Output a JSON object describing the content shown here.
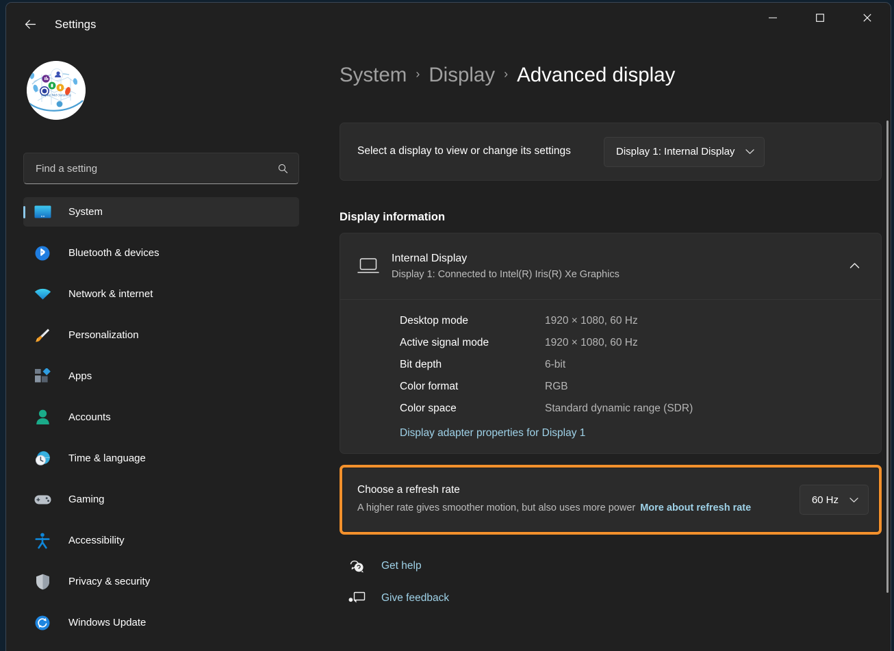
{
  "window": {
    "app_title": "Settings",
    "back_icon": "back-arrow-icon",
    "minimize_icon": "minimize-icon",
    "maximize_icon": "maximize-icon",
    "close_icon": "close-icon"
  },
  "sidebar": {
    "avatar_alt": "user-avatar-network-globe-logo",
    "search": {
      "placeholder": "Find a setting",
      "value": "",
      "icon": "search-icon"
    },
    "items": [
      {
        "label": "System",
        "icon": "monitor-icon",
        "selected": true
      },
      {
        "label": "Bluetooth & devices",
        "icon": "bluetooth-icon",
        "selected": false
      },
      {
        "label": "Network & internet",
        "icon": "wifi-icon",
        "selected": false
      },
      {
        "label": "Personalization",
        "icon": "paintbrush-icon",
        "selected": false
      },
      {
        "label": "Apps",
        "icon": "apps-grid-icon",
        "selected": false
      },
      {
        "label": "Accounts",
        "icon": "person-icon",
        "selected": false
      },
      {
        "label": "Time & language",
        "icon": "clock-globe-icon",
        "selected": false
      },
      {
        "label": "Gaming",
        "icon": "gamepad-icon",
        "selected": false
      },
      {
        "label": "Accessibility",
        "icon": "accessibility-person-icon",
        "selected": false
      },
      {
        "label": "Privacy & security",
        "icon": "shield-icon",
        "selected": false
      },
      {
        "label": "Windows Update",
        "icon": "refresh-circle-icon",
        "selected": false
      }
    ]
  },
  "breadcrumb": {
    "parts": [
      "System",
      "Display",
      "Advanced display"
    ],
    "separator": "›"
  },
  "select_display": {
    "label": "Select a display to view or change its settings",
    "dropdown_value": "Display 1: Internal Display",
    "chevron_icon": "chevron-down-icon"
  },
  "display_information": {
    "section_title": "Display information",
    "display_name": "Internal Display",
    "display_subtitle": "Display 1: Connected to Intel(R) Iris(R) Xe Graphics",
    "monitor_icon": "laptop-display-icon",
    "collapse_icon": "chevron-up-icon",
    "specs": [
      {
        "key": "Desktop mode",
        "value": "1920 × 1080, 60 Hz"
      },
      {
        "key": "Active signal mode",
        "value": "1920 × 1080, 60 Hz"
      },
      {
        "key": "Bit depth",
        "value": "6-bit"
      },
      {
        "key": "Color format",
        "value": "RGB"
      },
      {
        "key": "Color space",
        "value": "Standard dynamic range (SDR)"
      }
    ],
    "adapter_link": "Display adapter properties for Display 1"
  },
  "refresh_rate": {
    "title": "Choose a refresh rate",
    "description": "A higher rate gives smoother motion, but also uses more power",
    "more_link": "More about refresh rate",
    "dropdown_value": "60 Hz",
    "chevron_icon": "chevron-down-icon",
    "highlight_color": "#f2902c"
  },
  "bottom_links": [
    {
      "label": "Get help",
      "icon": "help-question-icon"
    },
    {
      "label": "Give feedback",
      "icon": "feedback-icon"
    }
  ],
  "colors": {
    "window_bg": "#202020",
    "card_bg": "#2b2b2b",
    "accent_link": "#9fd2e8",
    "selection_accent": "#8cc7e8",
    "highlight_orange": "#f2902c"
  }
}
